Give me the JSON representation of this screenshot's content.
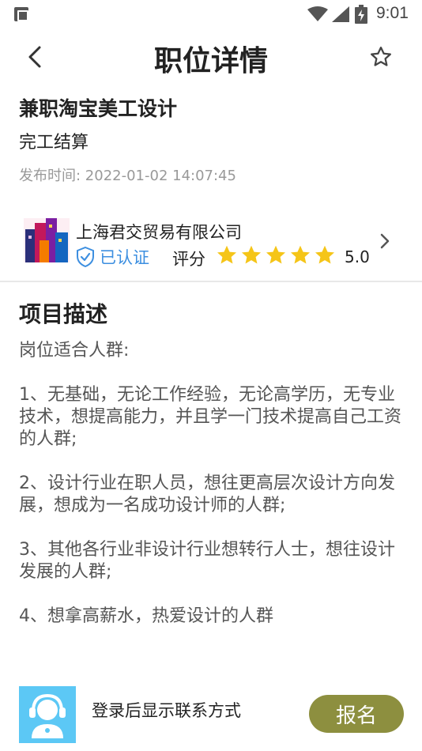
{
  "status_bar": {
    "time": "9:01",
    "icons": [
      "app-notification-icon",
      "wifi-icon",
      "cell-signal-icon",
      "battery-charging-icon"
    ]
  },
  "header": {
    "title": "职位详情",
    "back_icon": "chevron-left-icon",
    "favorite_icon": "star-outline-icon"
  },
  "job": {
    "title": "兼职淘宝美工设计",
    "settlement": "完工结算",
    "publish_time": "发布时间: 2022-01-02 14:07:45"
  },
  "company": {
    "name": "上海君交贸易有限公司",
    "verified_label": "已认证",
    "rating_label": "评分",
    "rating_value": "5.0",
    "stars": 5,
    "colors": {
      "verified": "#3d8fe0",
      "star": "#f5c518"
    }
  },
  "description": {
    "title": "项目描述",
    "paragraphs": [
      "岗位适合人群:",
      "",
      "1、无基础，无论工作经验，无论高学历，无专业技术，想提高能力，并且学一门技术提高自己工资的人群;",
      "",
      "2、设计行业在职人员，想往更高层次设计方向发展，想成为一名成功设计师的人群;",
      "",
      "3、其他各行业非设计行业想转行人士，想往设计发展的人群;",
      "",
      "4、想拿高薪水，热爱设计的人群"
    ]
  },
  "bottom": {
    "contact_text": "登录后显示联系方式",
    "apply_label": "报名",
    "colors": {
      "avatar_bg": "#5cc8f5",
      "apply_bg": "#8d8f3f"
    }
  }
}
